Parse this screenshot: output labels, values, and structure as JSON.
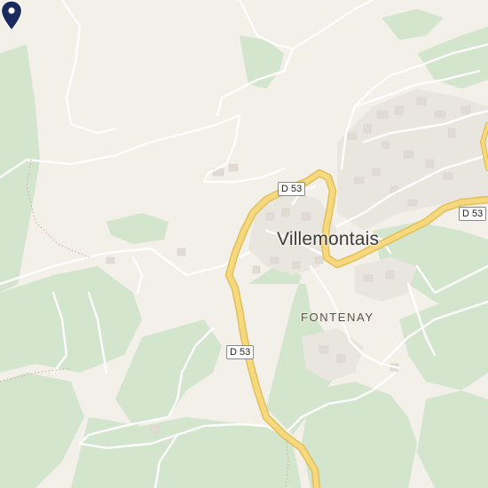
{
  "map": {
    "town_label": "Villemontais",
    "hamlet_label": "FONTENAY",
    "road_shields": [
      "D 53",
      "D 53",
      "D 53"
    ],
    "pin": {
      "icon": "location-pin-icon",
      "color": "#1a2a5e"
    },
    "colors": {
      "land": "#f3efe9",
      "forest": "#d3e6cd",
      "road_major_fill": "#f6d97e",
      "road_major_casing": "#e2bf58",
      "road_minor": "#ffffff",
      "building": "#e6e1da"
    }
  }
}
